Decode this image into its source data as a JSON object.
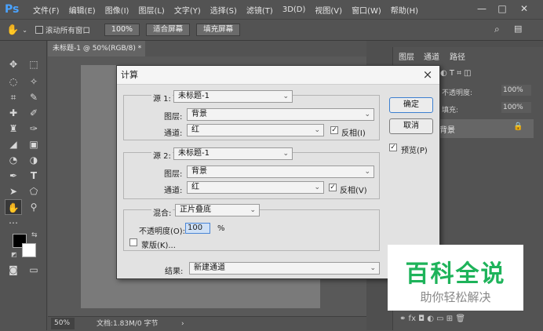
{
  "app": {
    "logo": "Ps"
  },
  "menu": [
    "文件(F)",
    "编辑(E)",
    "图像(I)",
    "图层(L)",
    "文字(Y)",
    "选择(S)",
    "滤镜(T)",
    "3D(D)",
    "视图(V)",
    "窗口(W)",
    "帮助(H)"
  ],
  "options": {
    "scroll_all_label": "滚动所有窗口",
    "zoom_value": "100%",
    "fit_screen": "适合屏幕",
    "fill_screen": "填充屏幕"
  },
  "document": {
    "tab_title": "未标题-1 @ 50%(RGB/8) *",
    "tab_close": "×",
    "zoom": "50%",
    "doc_info": "文档:1.83M/0 字节"
  },
  "panels": {
    "tabs": [
      "图层",
      "通道",
      "路径"
    ],
    "opacity_label": "不透明度:",
    "opacity_value": "100%",
    "fill_label": "填充:",
    "fill_value": "100%",
    "layer_name": "背景"
  },
  "dialog": {
    "title": "计算",
    "close": "×",
    "ok": "确定",
    "cancel": "取消",
    "preview": "预览(P)",
    "source1": {
      "label": "源 1:",
      "doc": "未标题-1",
      "layer_label": "图层:",
      "layer": "背景",
      "channel_label": "通道:",
      "channel": "红",
      "invert": "反相(I)"
    },
    "source2": {
      "label": "源 2:",
      "doc": "未标题-1",
      "layer_label": "图层:",
      "layer": "背景",
      "channel_label": "通道:",
      "channel": "红",
      "invert": "反相(V)"
    },
    "blend": {
      "label": "混合:",
      "mode": "正片叠底",
      "opacity_label": "不透明度(O):",
      "opacity_value": "100",
      "percent": "%",
      "mask": "蒙版(K)..."
    },
    "result": {
      "label": "结果:",
      "value": "新建通道"
    }
  },
  "watermark": {
    "title": "百科全说",
    "subtitle": "助你轻松解决"
  }
}
